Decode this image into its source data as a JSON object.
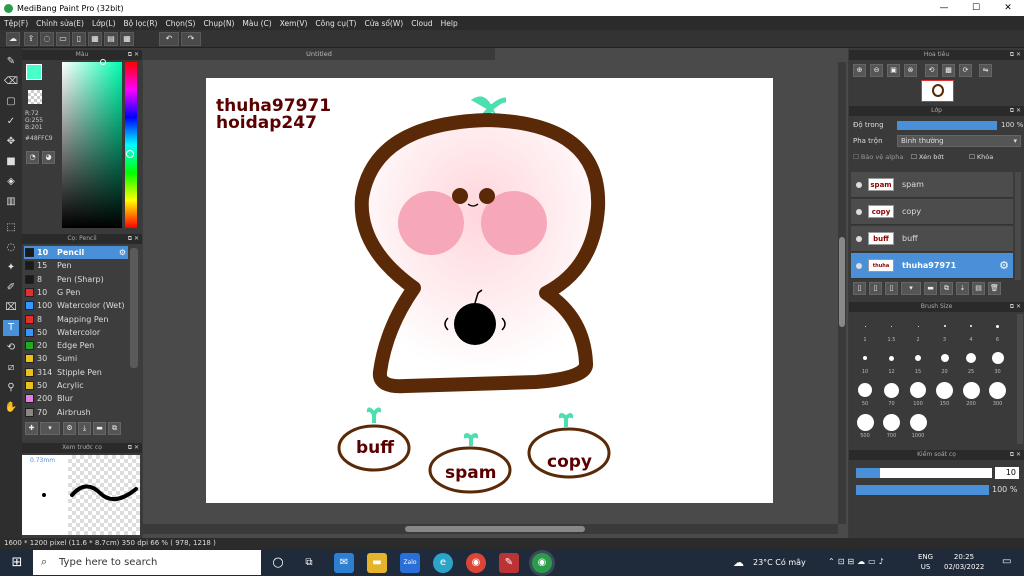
{
  "window": {
    "title": "MediBang Paint Pro (32bit)",
    "minimize": "—",
    "maximize": "☐",
    "close": "✕"
  },
  "menu": [
    "Tệp(F)",
    "Chỉnh sửa(E)",
    "Lớp(L)",
    "Bộ lọc(R)",
    "Chọn(S)",
    "Chụp(N)",
    "Màu (C)",
    "Xem(V)",
    "Công cụ(T)",
    "Cửa sổ(W)",
    "Cloud",
    "Help"
  ],
  "color_panel": {
    "title": "Màu",
    "r": "R:72",
    "g": "G:255",
    "b": "B:201",
    "hex": "#48FFC9",
    "fg": "#48ffc9"
  },
  "brush_panel": {
    "title": "Cọ: Pencil",
    "brushes": [
      {
        "size": "10",
        "name": "Pencil",
        "color": "#1a1a1a"
      },
      {
        "size": "15",
        "name": "Pen",
        "color": "#1a1a1a"
      },
      {
        "size": "8",
        "name": "Pen (Sharp)",
        "color": "#1a1a1a"
      },
      {
        "size": "10",
        "name": "G Pen",
        "color": "#e03030"
      },
      {
        "size": "100",
        "name": "Watercolor (Wet)",
        "color": "#3399ff"
      },
      {
        "size": "8",
        "name": "Mapping Pen",
        "color": "#e03030"
      },
      {
        "size": "50",
        "name": "Watercolor",
        "color": "#3399ff"
      },
      {
        "size": "20",
        "name": "Edge Pen",
        "color": "#22aa22"
      },
      {
        "size": "30",
        "name": "Sumi",
        "color": "#e8c020"
      },
      {
        "size": "314",
        "name": "Stipple Pen",
        "color": "#e8c020"
      },
      {
        "size": "50",
        "name": "Acrylic",
        "color": "#e8c020"
      },
      {
        "size": "200",
        "name": "Blur",
        "color": "#e080e0"
      },
      {
        "size": "70",
        "name": "Airbrush",
        "color": "#888888"
      }
    ]
  },
  "preview_panel": {
    "title": "Xem trước cọ",
    "size": "0.73mm"
  },
  "canvas": {
    "tab": "Untitled",
    "watermark_line1": "thuha97971",
    "watermark_line2": "hoidap247",
    "labels": {
      "buff": "buff",
      "spam": "spam",
      "copy": "copy"
    }
  },
  "navigator": {
    "title": "Hoa tiêu"
  },
  "layer_panel": {
    "title": "Lớp",
    "opacity_label": "Độ trong",
    "opacity_value": "100 %",
    "opacity_fraction": 1.0,
    "blend_label": "Pha trộn",
    "blend_value": "Bình thường",
    "protect_alpha": "Bảo vệ alpha",
    "clipping": "Xén bớt",
    "lock": "Khóa",
    "layers": [
      {
        "name": "spam",
        "thumb": "spam"
      },
      {
        "name": "copy",
        "thumb": "copy"
      },
      {
        "name": "buff",
        "thumb": "buff"
      },
      {
        "name": "thuha97971",
        "thumb": "thuha"
      }
    ]
  },
  "brush_size_panel": {
    "title": "Brush Size",
    "sizes": [
      "1",
      "1.5",
      "2",
      "3",
      "4",
      "6",
      "10",
      "12",
      "15",
      "20",
      "25",
      "30",
      "50",
      "70",
      "100",
      "150",
      "200",
      "300",
      "500",
      "700",
      "1000"
    ]
  },
  "control_panel": {
    "title": "Kiểm soát cọ",
    "size_value": "10",
    "opacity_value": "100 %",
    "size_fraction": 0.18,
    "opacity_fraction": 1.0
  },
  "status": {
    "text": "1600 * 1200 pixel   (11.6 * 8.7cm)   350 dpi   66 %   ( 978, 1218 )"
  },
  "taskbar": {
    "search_placeholder": "Type here to search",
    "weather": "23°C Có mây",
    "lang1": "ENG",
    "lang2": "US",
    "time": "20:25",
    "date": "02/03/2022"
  }
}
